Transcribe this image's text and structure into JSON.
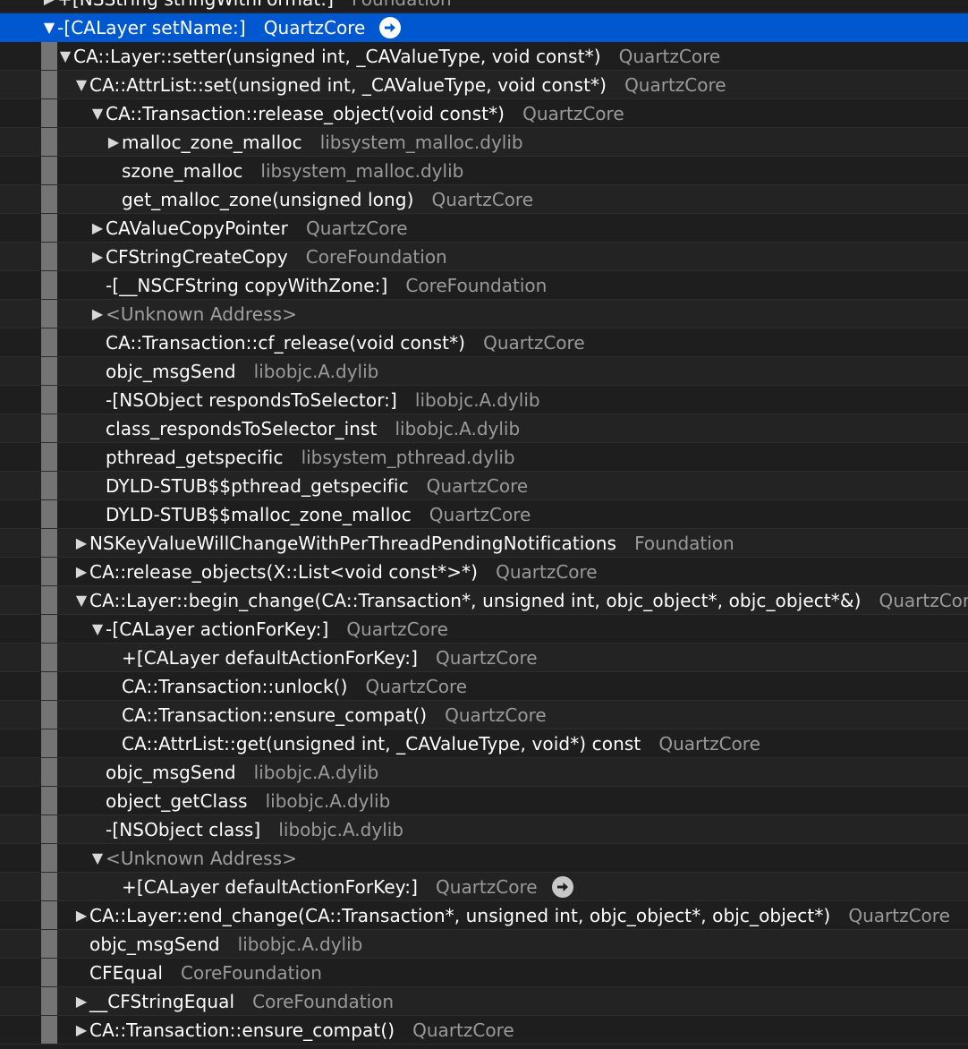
{
  "rows": [
    {
      "disclosure": "collapsed",
      "depth": 0,
      "symbol": "+[NSString stringWithFormat:]",
      "library": "Foundation",
      "top": true
    },
    {
      "disclosure": "expanded",
      "depth": 0,
      "symbol": "-[CALayer setName:]",
      "library": "QuartzCore",
      "selected": true,
      "goto": true
    },
    {
      "disclosure": "expanded",
      "depth": 1,
      "symbol": "CA::Layer::setter(unsigned int, _CAValueType, void const*)",
      "library": "QuartzCore"
    },
    {
      "disclosure": "expanded",
      "depth": 2,
      "symbol": "CA::AttrList::set(unsigned int, _CAValueType, void const*)",
      "library": "QuartzCore"
    },
    {
      "disclosure": "expanded",
      "depth": 3,
      "symbol": "CA::Transaction::release_object(void const*)",
      "library": "QuartzCore"
    },
    {
      "disclosure": "collapsed",
      "depth": 4,
      "symbol": "malloc_zone_malloc",
      "library": "libsystem_malloc.dylib"
    },
    {
      "disclosure": "none",
      "depth": 4,
      "symbol": "szone_malloc",
      "library": "libsystem_malloc.dylib"
    },
    {
      "disclosure": "none",
      "depth": 4,
      "symbol": "get_malloc_zone(unsigned long)",
      "library": "QuartzCore"
    },
    {
      "disclosure": "collapsed",
      "depth": 3,
      "symbol": "CAValueCopyPointer",
      "library": "QuartzCore"
    },
    {
      "disclosure": "collapsed",
      "depth": 3,
      "symbol": "CFStringCreateCopy",
      "library": "CoreFoundation"
    },
    {
      "disclosure": "none",
      "depth": 3,
      "symbol": "-[__NSCFString copyWithZone:]",
      "library": "CoreFoundation"
    },
    {
      "disclosure": "collapsed",
      "depth": 3,
      "symbol": "<Unknown Address>",
      "library": "",
      "dim": true
    },
    {
      "disclosure": "none",
      "depth": 3,
      "symbol": "CA::Transaction::cf_release(void const*)",
      "library": "QuartzCore"
    },
    {
      "disclosure": "none",
      "depth": 3,
      "symbol": "objc_msgSend",
      "library": "libobjc.A.dylib"
    },
    {
      "disclosure": "none",
      "depth": 3,
      "symbol": "-[NSObject respondsToSelector:]",
      "library": "libobjc.A.dylib"
    },
    {
      "disclosure": "none",
      "depth": 3,
      "symbol": "class_respondsToSelector_inst",
      "library": "libobjc.A.dylib"
    },
    {
      "disclosure": "none",
      "depth": 3,
      "symbol": "pthread_getspecific",
      "library": "libsystem_pthread.dylib"
    },
    {
      "disclosure": "none",
      "depth": 3,
      "symbol": "DYLD-STUB$$pthread_getspecific",
      "library": "QuartzCore"
    },
    {
      "disclosure": "none",
      "depth": 3,
      "symbol": "DYLD-STUB$$malloc_zone_malloc",
      "library": "QuartzCore"
    },
    {
      "disclosure": "collapsed",
      "depth": 2,
      "symbol": "NSKeyValueWillChangeWithPerThreadPendingNotifications",
      "library": "Foundation"
    },
    {
      "disclosure": "collapsed",
      "depth": 2,
      "symbol": "CA::release_objects(X::List<void const*>*)",
      "library": "QuartzCore"
    },
    {
      "disclosure": "expanded",
      "depth": 2,
      "symbol": "CA::Layer::begin_change(CA::Transaction*, unsigned int, objc_object*, objc_object*&)",
      "library": "QuartzCore"
    },
    {
      "disclosure": "expanded",
      "depth": 3,
      "symbol": "-[CALayer actionForKey:]",
      "library": "QuartzCore"
    },
    {
      "disclosure": "none",
      "depth": 4,
      "symbol": "+[CALayer defaultActionForKey:]",
      "library": "QuartzCore"
    },
    {
      "disclosure": "none",
      "depth": 4,
      "symbol": "CA::Transaction::unlock()",
      "library": "QuartzCore"
    },
    {
      "disclosure": "none",
      "depth": 4,
      "symbol": "CA::Transaction::ensure_compat()",
      "library": "QuartzCore"
    },
    {
      "disclosure": "none",
      "depth": 4,
      "symbol": "CA::AttrList::get(unsigned int, _CAValueType, void*) const",
      "library": "QuartzCore"
    },
    {
      "disclosure": "none",
      "depth": 3,
      "symbol": "objc_msgSend",
      "library": "libobjc.A.dylib"
    },
    {
      "disclosure": "none",
      "depth": 3,
      "symbol": "object_getClass",
      "library": "libobjc.A.dylib"
    },
    {
      "disclosure": "none",
      "depth": 3,
      "symbol": "-[NSObject class]",
      "library": "libobjc.A.dylib"
    },
    {
      "disclosure": "expanded",
      "depth": 3,
      "symbol": "<Unknown Address>",
      "library": "",
      "dim": true
    },
    {
      "disclosure": "none",
      "depth": 4,
      "symbol": "+[CALayer defaultActionForKey:]",
      "library": "QuartzCore",
      "goto": true
    },
    {
      "disclosure": "collapsed",
      "depth": 2,
      "symbol": "CA::Layer::end_change(CA::Transaction*, unsigned int, objc_object*, objc_object*)",
      "library": "QuartzCore"
    },
    {
      "disclosure": "none",
      "depth": 2,
      "symbol": "objc_msgSend",
      "library": "libobjc.A.dylib"
    },
    {
      "disclosure": "none",
      "depth": 2,
      "symbol": "CFEqual",
      "library": "CoreFoundation"
    },
    {
      "disclosure": "collapsed",
      "depth": 2,
      "symbol": "__CFStringEqual",
      "library": "CoreFoundation"
    },
    {
      "disclosure": "collapsed",
      "depth": 2,
      "symbol": "CA::Transaction::ensure_compat()",
      "library": "QuartzCore"
    }
  ]
}
